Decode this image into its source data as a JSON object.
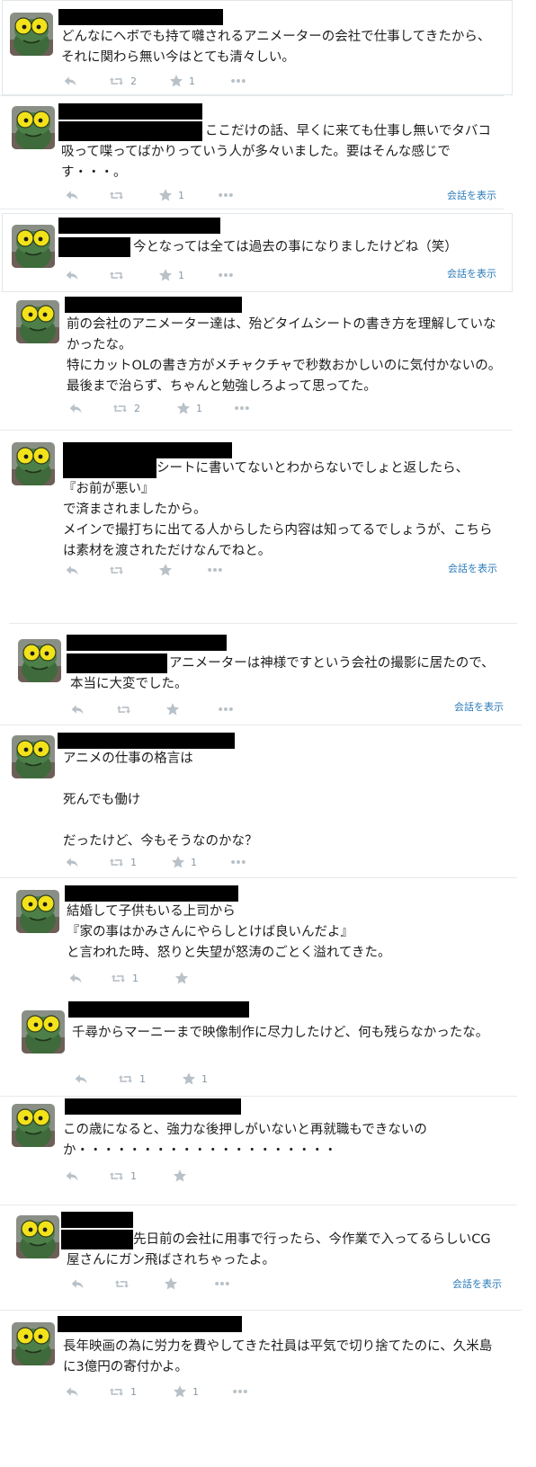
{
  "conversation_label": "会話を表示",
  "tweets": [
    {
      "text": "どんなにヘボでも持て囃されるアニメーターの会社で仕事してきたから、それに関わら無い今はとても清々しい。",
      "retweets": "2",
      "likes": "1"
    },
    {
      "text": "ここだけの話、早くに来ても仕事し無いでタバコ吸って喋ってばかりっていう人が多々いました。要はそんな感じです・・・。",
      "retweets": "",
      "likes": "1"
    },
    {
      "text": "今となっては全ては過去の事になりましたけどね（笑）",
      "retweets": "",
      "likes": "1"
    },
    {
      "text": "前の会社のアニメーター達は、殆どタイムシートの書き方を理解していなかったな。\n特にカットOLの書き方がメチャクチャで秒数おかしいのに気付かないの。最後まで治らず、ちゃんと勉強しろよって思ってた。",
      "retweets": "2",
      "likes": "1"
    },
    {
      "text": "シートに書いてないとわからないでしょと返したら、\n『お前が悪い』\nで済まされましたから。\nメインで撮打ちに出てる人からしたら内容は知ってるでしょうが、こちらは素材を渡されただけなんでねと。",
      "retweets": "",
      "likes": ""
    },
    {
      "text": "アニメーターは神様ですという会社の撮影に居たので、本当に大変でした。",
      "retweets": "",
      "likes": ""
    },
    {
      "text": "アニメの仕事の格言は\n\n死んでも働け\n\nだったけど、今もそうなのかな？",
      "retweets": "1",
      "likes": "1"
    },
    {
      "text": "結婚して子供もいる上司から\n『家の事はかみさんにやらしとけば良いんだよ』\nと言われた時、怒りと失望が怒涛のごとく溢れてきた。",
      "retweets": "1",
      "likes": ""
    },
    {
      "text": "千尋からマーニーまで映像制作に尽力したけど、何も残らなかったな。",
      "retweets": "1",
      "likes": "1"
    },
    {
      "text": "この歳になると、強力な後押しがいないと再就職もできないのか・・・・・・・・・・・・・・・・・・・・",
      "retweets": "1",
      "likes": ""
    },
    {
      "text": "先日前の会社に用事で行ったら、今作業で入ってるらしいCG屋さんにガン飛ばされちゃったよ。",
      "retweets": "",
      "likes": ""
    },
    {
      "text": "長年映画の為に労力を費やしてきた社員は平気で切り捨てたのに、久米島に3億円の寄付かよ。",
      "retweets": "1",
      "likes": "1"
    }
  ]
}
